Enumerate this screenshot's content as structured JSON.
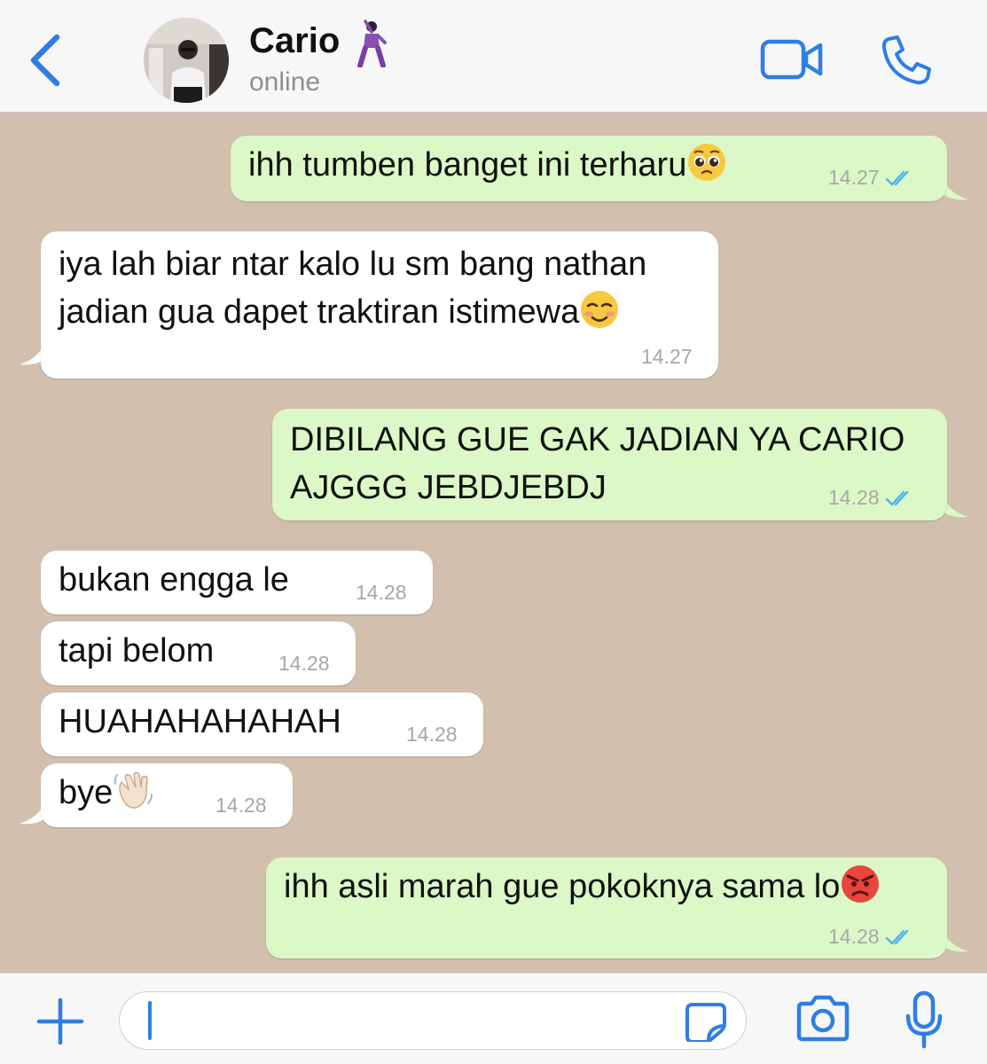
{
  "header": {
    "contact_name": "Cario",
    "contact_status": "online"
  },
  "messages": [
    {
      "direction": "out",
      "text": "ihh tumben banget ini terharu",
      "emoji": "pleading-face-emoji",
      "time": "14.27",
      "read": true
    },
    {
      "direction": "in",
      "lines": [
        "iya lah biar ntar kalo lu sm bang nathan",
        "jadian gua dapet traktiran istimewa"
      ],
      "emoji": "smiling-face-emoji",
      "time": "14.27"
    },
    {
      "direction": "out",
      "lines": [
        "DIBILANG GUE GAK JADIAN YA CARIO",
        "AJGGG JEBDJEBDJ"
      ],
      "time": "14.28",
      "read": true
    },
    {
      "direction": "in",
      "text": "bukan engga le",
      "time": "14.28"
    },
    {
      "direction": "in",
      "text": "tapi belom",
      "time": "14.28"
    },
    {
      "direction": "in",
      "text": "HUAHAHAHAHAH",
      "time": "14.28"
    },
    {
      "direction": "in",
      "text": "bye",
      "emoji": "waving-hand-emoji",
      "time": "14.28"
    },
    {
      "direction": "out",
      "text": "ihh asli marah gue pokoknya sama lo",
      "emoji": "angry-face-emoji",
      "time": "14.28",
      "read": true
    }
  ],
  "composer": {
    "value": ""
  },
  "colors": {
    "accent": "#2f7ee6",
    "chat_background": "#d2bfae",
    "outgoing_bubble": "#dcf8c6",
    "incoming_bubble": "#ffffff",
    "read_ticks": "#4fb3f2",
    "timestamp": "#a7a7a7"
  }
}
